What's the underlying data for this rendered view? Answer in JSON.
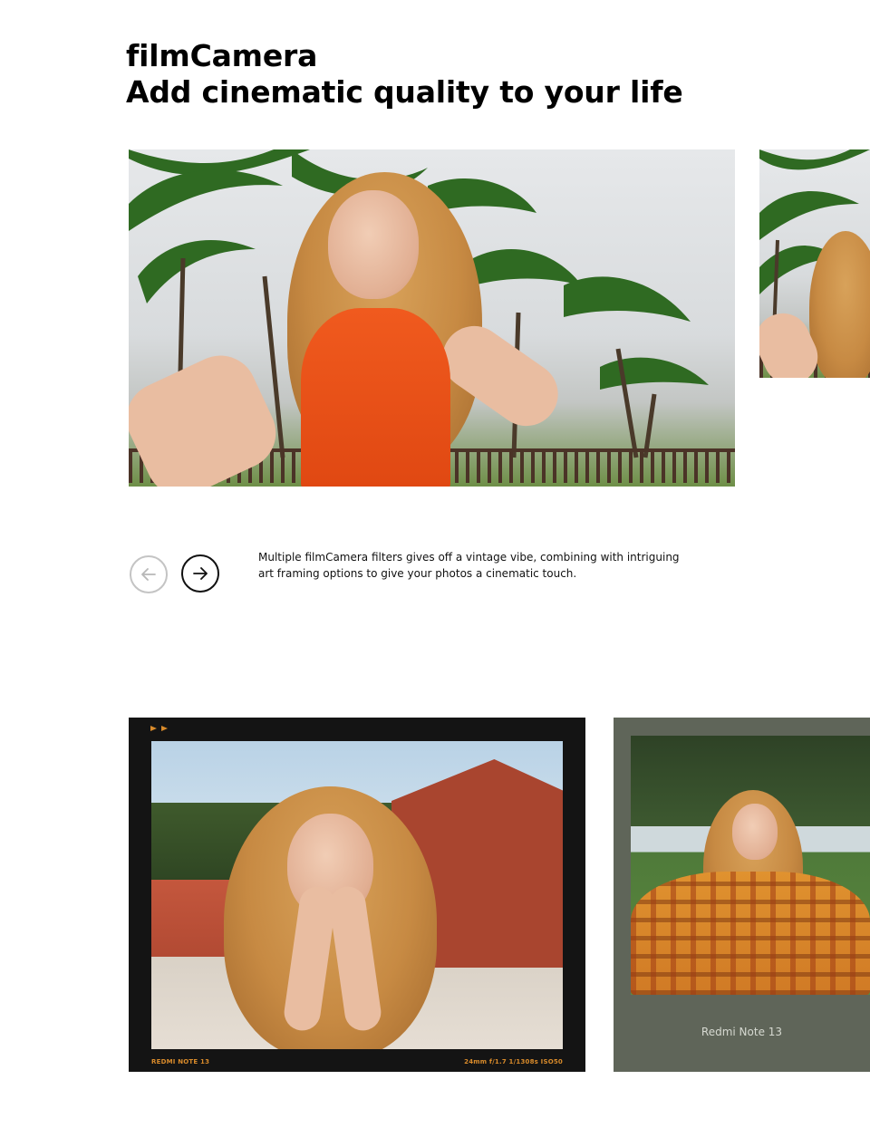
{
  "header": {
    "line1": "filmCamera",
    "line2": "Add cinematic quality to your life"
  },
  "carousel": {
    "prev_icon": "arrow-left-icon",
    "next_icon": "arrow-right-icon",
    "description": "Multiple filmCamera filters gives off a vintage vibe, combining with intriguing art framing options to give your photos a cinematic touch."
  },
  "film_frames": [
    {
      "caption_left": "REDMI NOTE 13",
      "caption_right": "24mm  f/1.7  1/1308s  ISO50",
      "accent": "#d98b2b"
    },
    {
      "caption": "Redmi Note 13"
    }
  ],
  "colors": {
    "prev_button_border": "#c4c4c4",
    "next_button_border": "#111111",
    "film_frame_dark": "#141414",
    "film_frame_green": "#5f6559"
  }
}
